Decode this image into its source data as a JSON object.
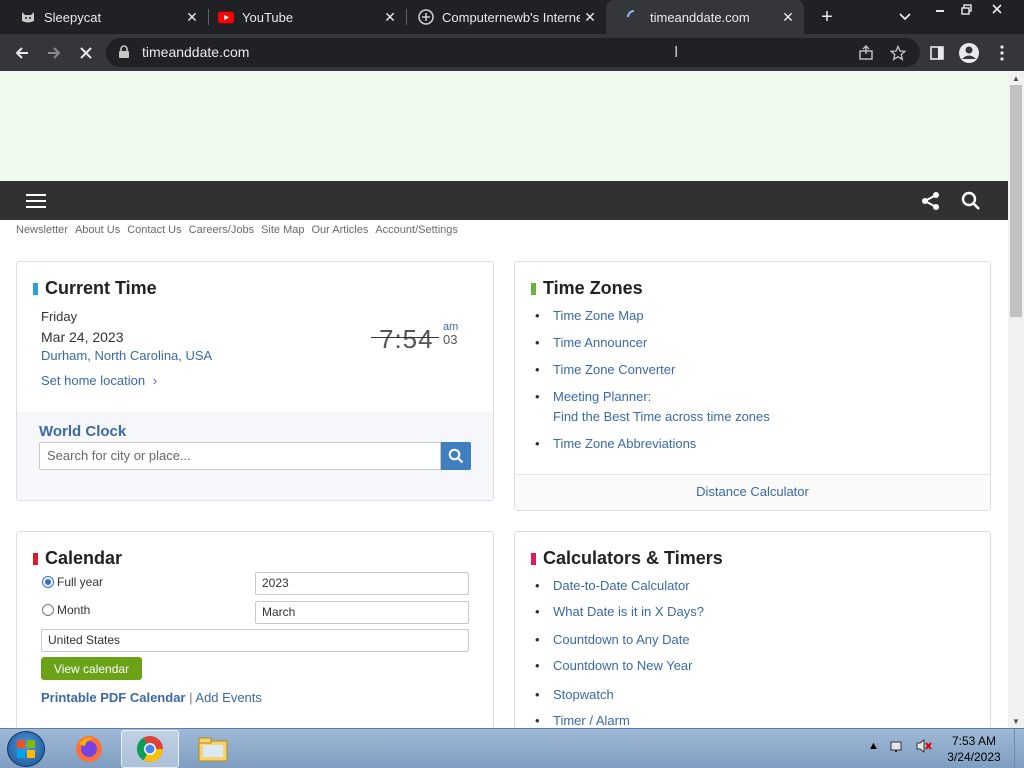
{
  "browser": {
    "tabs": [
      {
        "title": "Sleepycat",
        "icon": "cat-icon",
        "active": false
      },
      {
        "title": "YouTube",
        "icon": "youtube-icon",
        "active": false
      },
      {
        "title": "Computernewb's Internet",
        "icon": "computernewb-icon",
        "active": false
      },
      {
        "title": "timeanddate.com",
        "icon": "loading-icon",
        "active": true
      }
    ],
    "url": "timeanddate.com"
  },
  "site": {
    "top_links": [
      "Newsletter",
      "About Us",
      "Contact Us",
      "Careers/Jobs",
      "Site Map",
      "Our Articles",
      "Account/Settings"
    ],
    "current_time": {
      "title": "Current Time",
      "title_color": "#2a9fd6",
      "day": "Friday",
      "date": "Mar 24, 2023",
      "location": "Durham, North Carolina, USA",
      "set_home": "Set home location",
      "time": "7:54",
      "ampm": "am",
      "seconds": "03",
      "world_clock_title": "World Clock",
      "search_placeholder": "Search for city or place..."
    },
    "time_zones": {
      "title": "Time Zones",
      "title_color": "#6ab23e",
      "links": [
        "Time Zone Map",
        "Time Announcer",
        "Time Zone Converter",
        "Meeting Planner:",
        "Time Zone Abbreviations"
      ],
      "meeting_planner_sub": "Find the Best Time across time zones",
      "footer_link": "Distance Calculator"
    },
    "calendar": {
      "title": "Calendar",
      "title_color": "#d61e2a",
      "full_year_label": "Full year",
      "month_label": "Month",
      "year_value": "2023",
      "month_value": "March",
      "country_value": "United States",
      "view_button": "View calendar",
      "printable_pdf": "Printable PDF Calendar",
      "separator": "|",
      "add_events": "Add Events"
    },
    "calculators": {
      "title": "Calculators & Timers",
      "title_color": "#d61e5a",
      "links": [
        "Date-to-Date Calculator",
        "What Date is it in X Days?",
        "Countdown to Any Date",
        "Countdown to New Year",
        "Stopwatch",
        "Timer / Alarm"
      ]
    }
  },
  "taskbar": {
    "time": "7:53 AM",
    "date": "3/24/2023"
  }
}
